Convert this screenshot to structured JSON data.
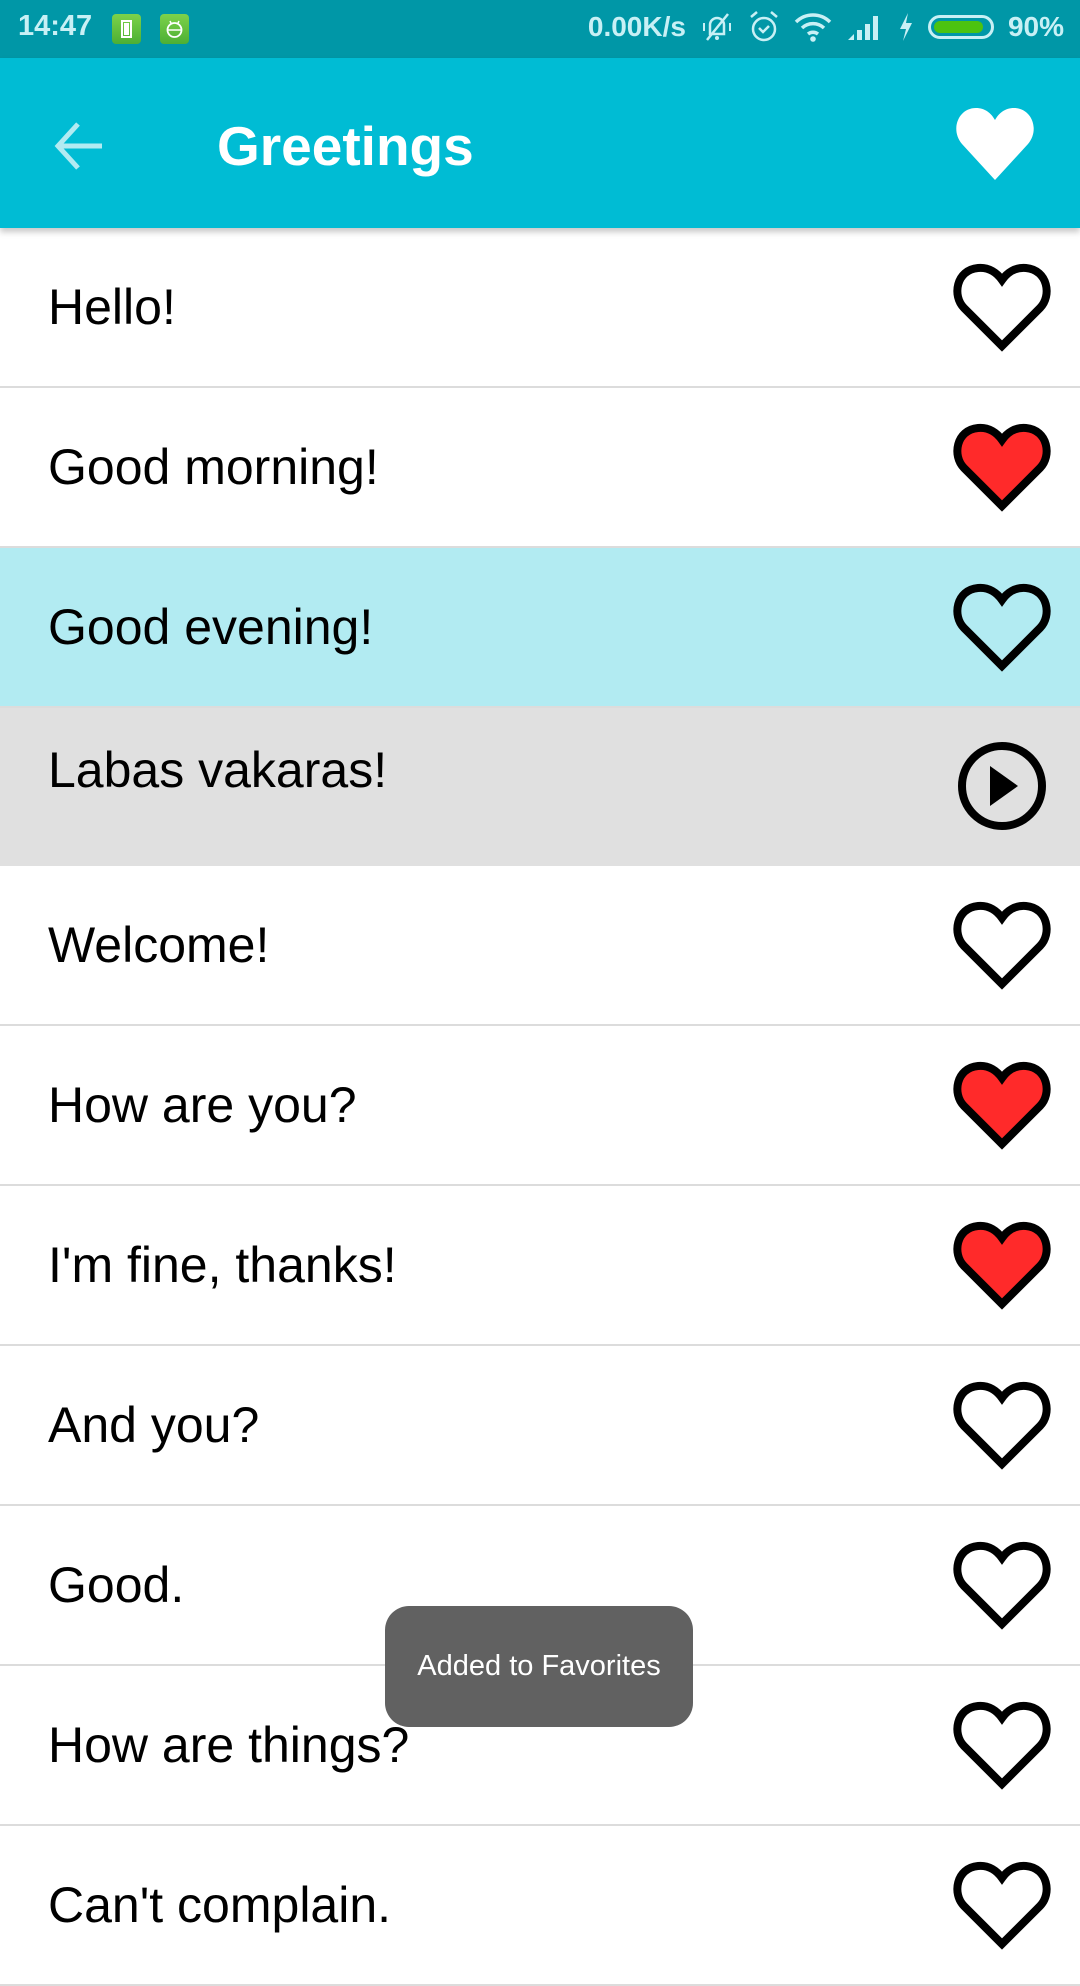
{
  "status_bar": {
    "time": "14:47",
    "left_icons": [
      "battery-saver-icon",
      "android-debug-icon"
    ],
    "network_speed": "0.00K/s",
    "right_icons": [
      "vibrate-silent-icon",
      "alarm-icon",
      "wifi-icon",
      "signal-icon",
      "charging-icon"
    ],
    "battery_percent": "90%",
    "battery_level": 0.9
  },
  "app_bar": {
    "title": "Greetings",
    "back_icon": "arrow-left-icon",
    "action_icon": "heart-filled-icon"
  },
  "colors": {
    "status_bar": "#0097a7",
    "app_bar": "#00bcd4",
    "highlight_row": "#b2ebf2",
    "expanded_row": "#e0e0e0",
    "favorite_red": "#ff2a2a",
    "toast": "#616161"
  },
  "phrases": [
    {
      "text": "Hello!",
      "favorite": false,
      "state": "normal"
    },
    {
      "text": "Good morning!",
      "favorite": true,
      "state": "normal"
    },
    {
      "text": "Good evening!",
      "favorite": false,
      "state": "highlight"
    },
    {
      "text": "Labas vakaras!",
      "favorite": false,
      "state": "expanded",
      "action": "play"
    },
    {
      "text": "Welcome!",
      "favorite": false,
      "state": "normal"
    },
    {
      "text": "How are you?",
      "favorite": true,
      "state": "normal"
    },
    {
      "text": "I'm fine, thanks!",
      "favorite": true,
      "state": "normal"
    },
    {
      "text": "And you?",
      "favorite": false,
      "state": "normal"
    },
    {
      "text": "Good.",
      "favorite": false,
      "state": "normal"
    },
    {
      "text": "How are things?",
      "favorite": false,
      "state": "normal"
    },
    {
      "text": "Can't complain.",
      "favorite": false,
      "state": "normal"
    }
  ],
  "toast": {
    "message": "Added to Favorites"
  }
}
